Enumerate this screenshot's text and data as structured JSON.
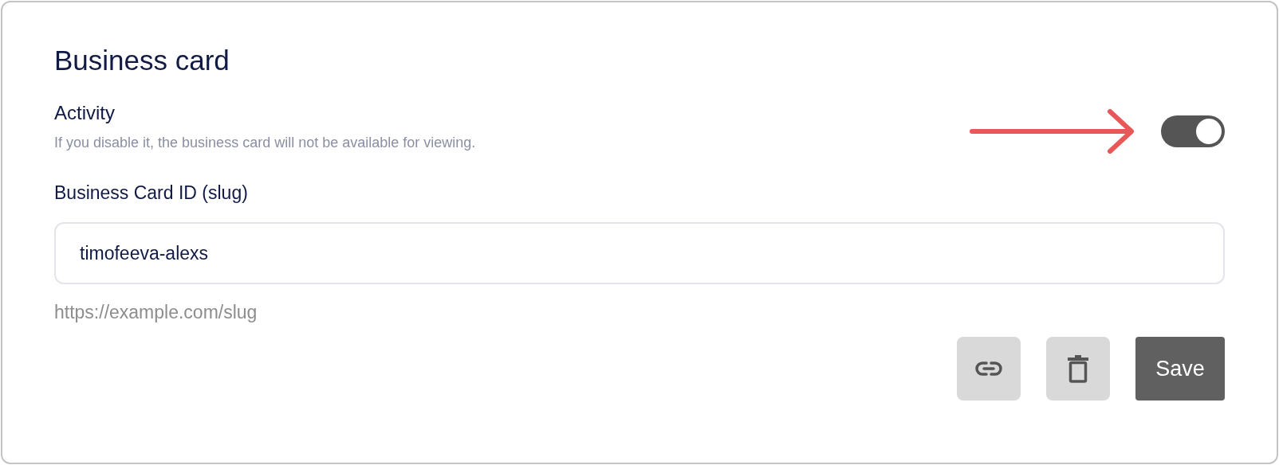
{
  "title": "Business card",
  "activity": {
    "label": "Activity",
    "description": "If you disable it, the business card will not be available for viewing.",
    "on": true
  },
  "slug": {
    "label": "Business Card ID (slug)",
    "value": "timofeeva-alexs",
    "hint": "https://example.com/slug"
  },
  "buttons": [
    {
      "kind": "link"
    },
    {
      "kind": "delete"
    },
    {
      "kind": "text",
      "label": "Save"
    }
  ]
}
